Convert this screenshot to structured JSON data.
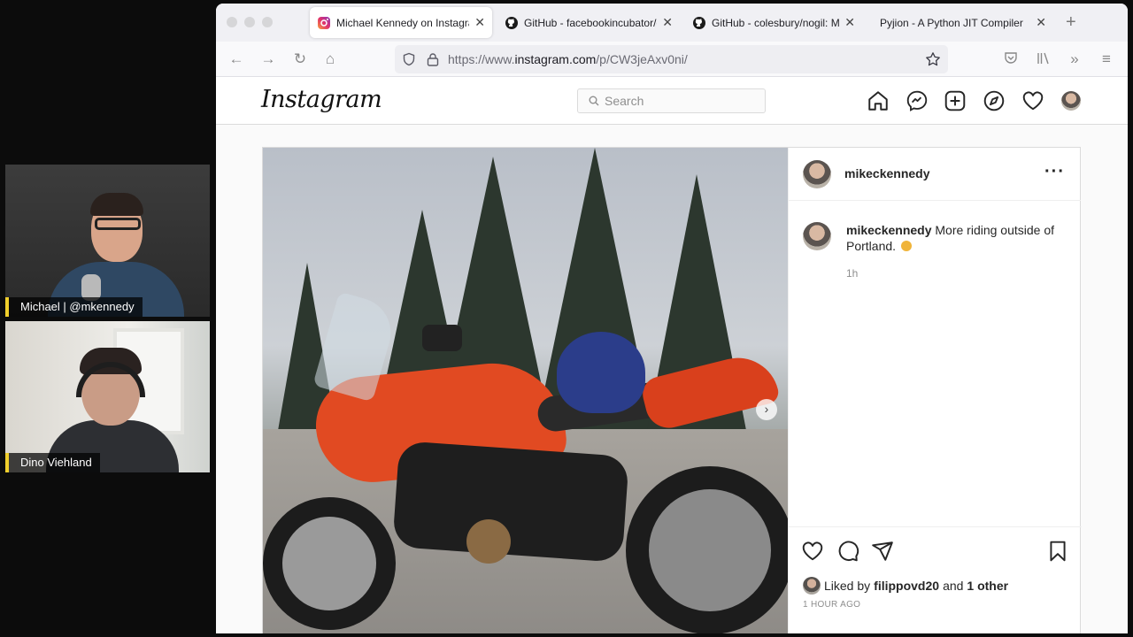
{
  "call": {
    "participants": [
      {
        "name": "Michael | @mkennedy"
      },
      {
        "name": "Dino Viehland"
      }
    ]
  },
  "browser": {
    "tabs": [
      {
        "title": "Michael Kennedy on Instagram",
        "active": true,
        "icon": "instagram-icon"
      },
      {
        "title": "GitHub - facebookincubator/c",
        "active": false,
        "icon": "github-icon"
      },
      {
        "title": "GitHub - colesbury/nogil: Mult",
        "active": false,
        "icon": "github-icon"
      },
      {
        "title": "Pyjion - A Python JIT Compiler",
        "active": false,
        "icon": "none"
      }
    ],
    "url_prefix": "https://www.",
    "url_domain": "instagram.com",
    "url_path": "/p/CW3jeAxv0ni/"
  },
  "instagram": {
    "logo": "Instagram",
    "search_placeholder": "Search",
    "nav_icons": [
      "home-icon",
      "messenger-icon",
      "new-post-icon",
      "explore-icon",
      "activity-heart-icon",
      "profile-avatar"
    ],
    "post": {
      "username": "mikeckennedy",
      "caption_user": "mikeckennedy",
      "caption_text": "More riding outside of Portland.",
      "relative_time": "1h",
      "liked_by_prefix": "Liked by",
      "liked_by_user": "filippovd20",
      "liked_by_and": "and",
      "liked_by_others": "1 other",
      "timestamp": "1 HOUR AGO"
    }
  }
}
